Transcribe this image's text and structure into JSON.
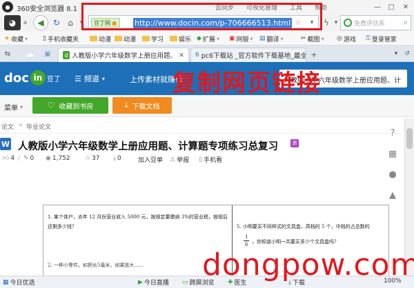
{
  "browser": {
    "title": "360安全浏览器 8.1",
    "window_menu": [
      "云同步",
      "可视化管理",
      "工具",
      "帮助"
    ],
    "url": "http://www.docin.com/p-706666513.html",
    "site_badge": "豆丁网",
    "search_placeholder": "免费评估系",
    "user_label": "a"
  },
  "favorites": {
    "items": [
      "收藏",
      "手机收藏夹",
      "动漫",
      "动漫",
      "学习",
      "娱乐",
      "扩展",
      "网银",
      "翻译",
      "截图",
      "游戏",
      "登录管家"
    ]
  },
  "tabs": [
    {
      "label": "人教版小学六年级数学上册应用题、",
      "active": true
    },
    {
      "label": "pc6下载站 _官方软件下载基地_最全",
      "active": false
    }
  ],
  "site": {
    "logo_doc": "doc",
    "logo_in": "in",
    "logo_cn": "豆丁",
    "channel": "频道",
    "upload": "上传素材就赚钱",
    "search_hint": "人教版小学六年级数学上册应用题、计",
    "menu": "菜单",
    "collect": "收藏到书房",
    "download": "下载文档"
  },
  "annotation": {
    "text": "复制网页链接",
    "color": "#e3171c"
  },
  "breadcrumb": [
    "论文",
    "毕业论文"
  ],
  "doc": {
    "badge": "W",
    "title": "人教版小学六年级数学上册应用题、计算题专项练习总复习",
    "vip": "资",
    "stats": {
      "likes": "4",
      "comments": "0",
      "views": "1,752",
      "ratings": "37",
      "downloads": "0",
      "add": "加入豆单",
      "report": "举报",
      "mobile": "手机看"
    },
    "q1_line1": "1. 某个体户，去年 12 月份营业收入 5000 元，按规定要缴纳 3%的营业税，按规后",
    "q1_line2": "还剩多少钱？",
    "q2_line1": "5. 小明要买不同样式的文具盒，高档的 5 个，中档的占总数的",
    "q2_line2": "1",
    "q2_line3": "6",
    "q2_line4": "，你知道小明一共要买多少个文具盒吗？",
    "q3_partial": "2. 一种小零件，如把长5毫米，如果放大......"
  },
  "status": {
    "items": [
      "今日优选",
      "今日直播",
      "跨屏浏览",
      "医生",
      "下载",
      "100%"
    ]
  },
  "watermark": "dongpow.com",
  "colors": {
    "accent_blue": "#1d6fb8",
    "green_btn": "#43a72a",
    "orange_btn": "#f18a1f",
    "highlight": "#3f7fd6"
  }
}
